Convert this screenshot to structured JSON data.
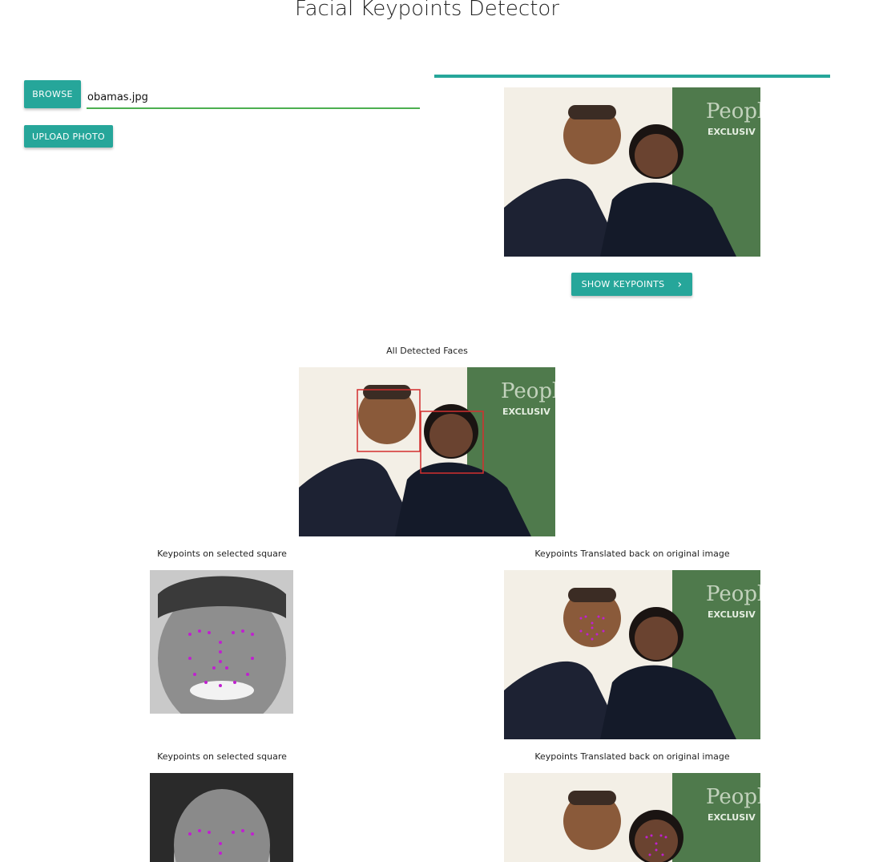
{
  "header": {
    "title": "Facial Keypoints Detector"
  },
  "upload_form": {
    "browse_label": "BROWSE",
    "file_name": "obamas.jpg",
    "upload_label": "UPLOAD PHOTO"
  },
  "preview": {
    "show_keypoints_label": "SHOW KEYPOINTS",
    "show_keypoints_icon": "chevron-right-icon",
    "upload_progress": 1.0
  },
  "detected": {
    "caption": "All Detected Faces",
    "watermark_logo": "People",
    "watermark_text": "EXCLUSIV"
  },
  "results": [
    {
      "left_caption": "Keypoints on selected square",
      "right_caption": "Keypoints Translated back on original image"
    },
    {
      "left_caption": "Keypoints on selected square",
      "right_caption": "Keypoints Translated back on original image"
    }
  ],
  "colors": {
    "accent": "#26a69a",
    "input_underline": "#4caf50",
    "face_box": "#d32f2f",
    "keypoint": "#e040fb"
  }
}
